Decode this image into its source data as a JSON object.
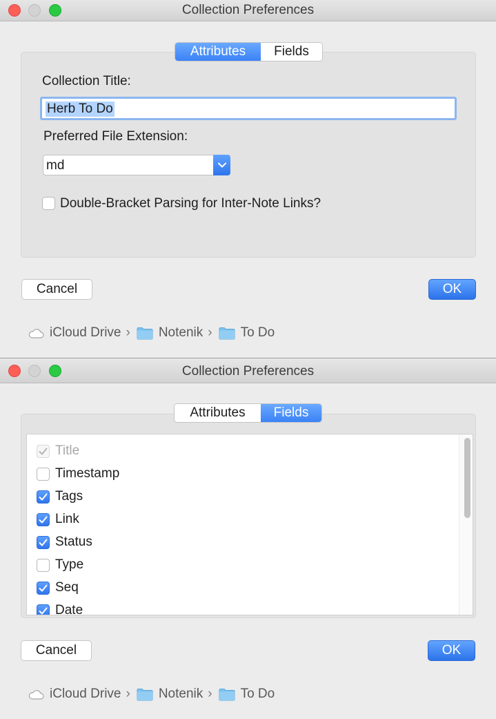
{
  "window1": {
    "title": "Collection Preferences",
    "tabs": [
      {
        "label": "Attributes",
        "selected": true
      },
      {
        "label": "Fields",
        "selected": false
      }
    ],
    "collection_title_label": "Collection Title:",
    "collection_title_value": "Herb To Do",
    "file_ext_label": "Preferred File Extension:",
    "file_ext_value": "md",
    "double_bracket_label": "Double-Bracket Parsing for Inter-Note Links?",
    "double_bracket_checked": false,
    "cancel_label": "Cancel",
    "ok_label": "OK",
    "path": [
      "iCloud Drive",
      "Notenik",
      "To Do"
    ]
  },
  "window2": {
    "title": "Collection Preferences",
    "tabs": [
      {
        "label": "Attributes",
        "selected": false
      },
      {
        "label": "Fields",
        "selected": true
      }
    ],
    "fields": [
      {
        "label": "Title",
        "checked": true,
        "disabled": true
      },
      {
        "label": "Timestamp",
        "checked": false
      },
      {
        "label": "Tags",
        "checked": true
      },
      {
        "label": "Link",
        "checked": true
      },
      {
        "label": "Status",
        "checked": true
      },
      {
        "label": "Type",
        "checked": false
      },
      {
        "label": "Seq",
        "checked": true
      },
      {
        "label": "Date",
        "checked": true
      }
    ],
    "cancel_label": "Cancel",
    "ok_label": "OK",
    "path": [
      "iCloud Drive",
      "Notenik",
      "To Do"
    ]
  },
  "colors": {
    "accent": "#3b82f6",
    "selection": "#b3d4fe"
  },
  "icons": {
    "cloud": "cloud-icon",
    "folder": "folder-icon",
    "check": "checkmark-icon",
    "chevron": "chevron-down-icon"
  }
}
